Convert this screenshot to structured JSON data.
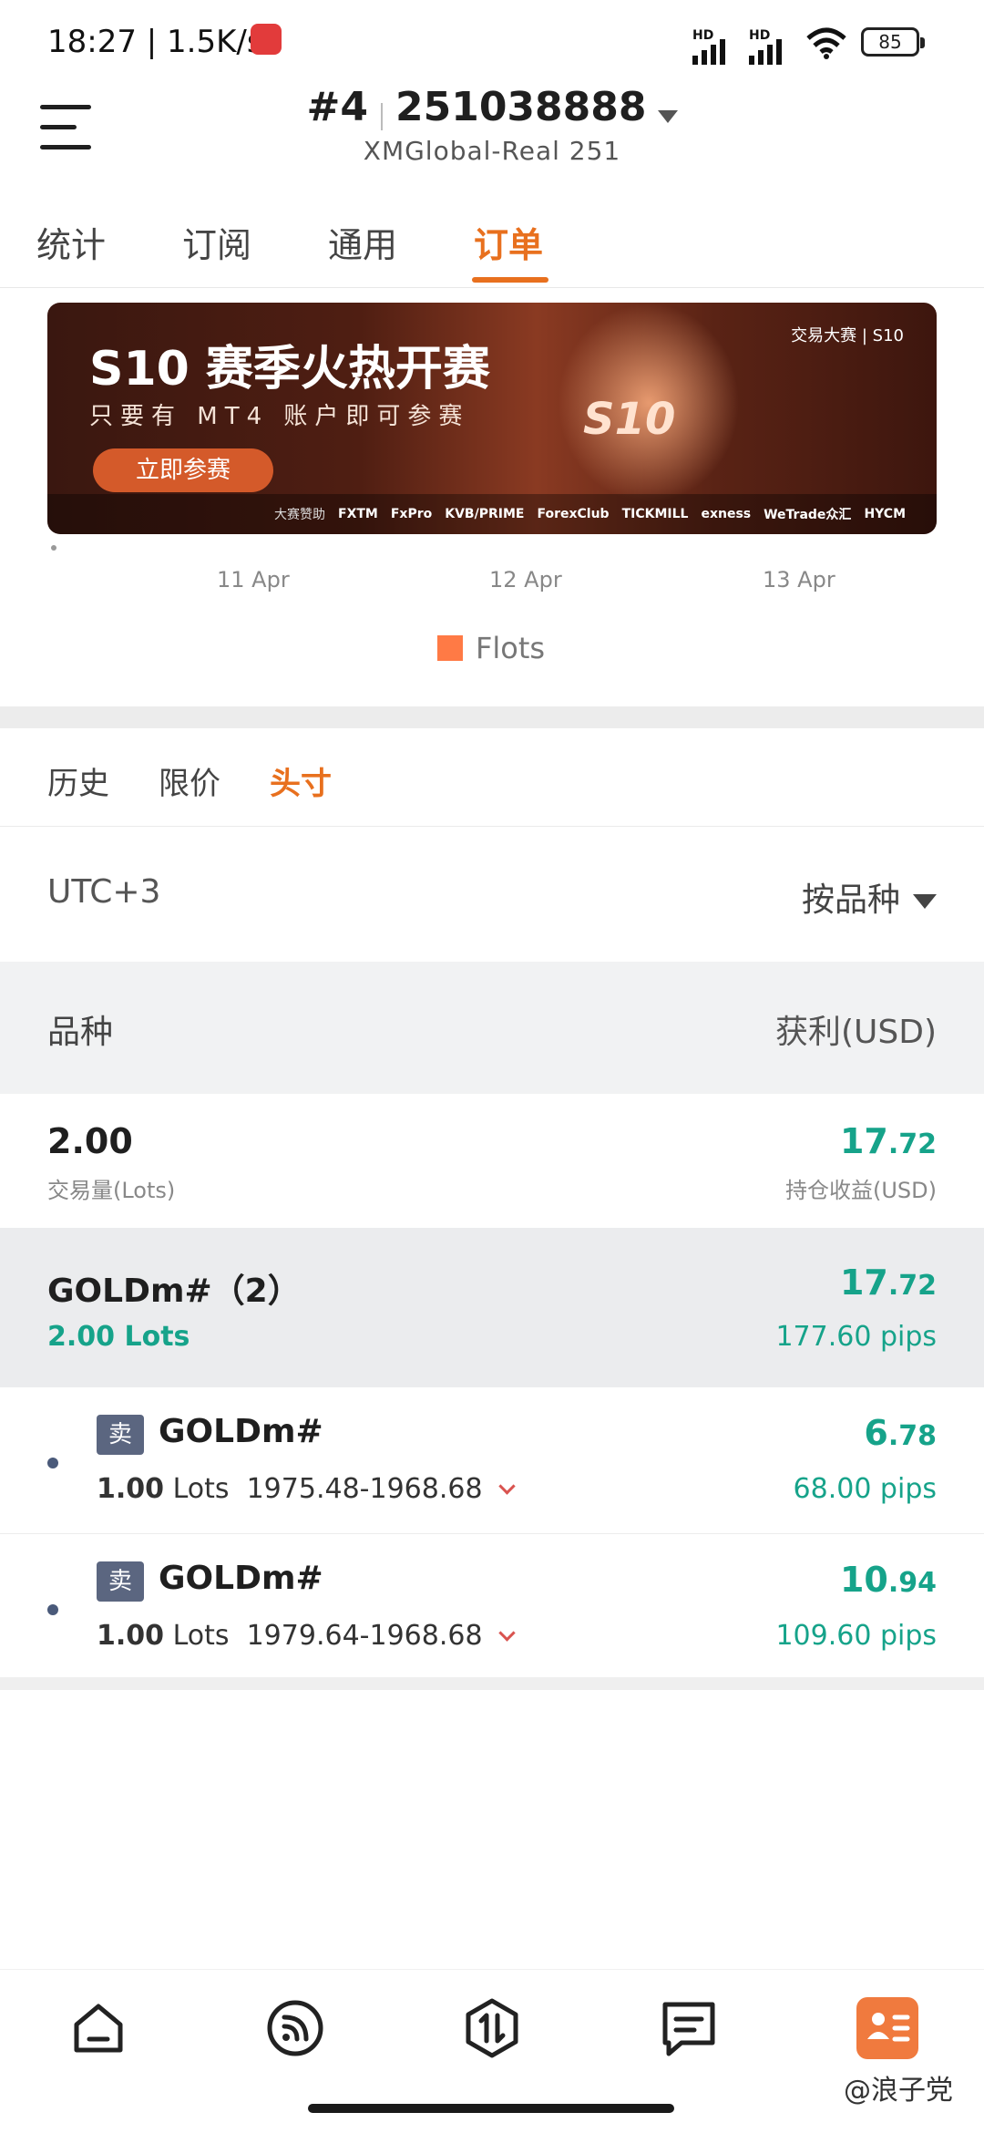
{
  "status_bar": {
    "time": "18:27 | 1.5K/s",
    "signal1_label": "HD",
    "signal2_label": "HD",
    "battery": "85"
  },
  "header": {
    "account_no": "#4",
    "account_id": "251038888",
    "server": "XMGlobal-Real 251"
  },
  "tabs": [
    "统计",
    "订阅",
    "通用",
    "订单"
  ],
  "active_tab": "订单",
  "banner": {
    "title": "S10 赛季火热开赛",
    "subtitle": "只要有 MT4 账户即可参赛",
    "cta": "立即参赛",
    "brand": "交易大赛 | S10",
    "center_text": "S10",
    "sponsor_label": "大赛赞助",
    "sponsors": [
      "FXTM",
      "FxPro",
      "KVB/PRIME",
      "ForexClub",
      "TICKMILL",
      "exness",
      "WeTrade众汇",
      "HYCM"
    ]
  },
  "chart_data": {
    "type": "bar",
    "categories": [
      "11 Apr",
      "12 Apr",
      "13 Apr"
    ],
    "series": [
      {
        "name": "Flots",
        "color": "#ff7a45"
      }
    ]
  },
  "subtabs": [
    "历史",
    "限价",
    "头寸"
  ],
  "active_subtab": "头寸",
  "filter": {
    "timezone": "UTC+3",
    "sort": "按品种"
  },
  "table_header": {
    "left": "品种",
    "right": "获利(USD)"
  },
  "summary": {
    "volume": "2.00",
    "volume_label": "交易量(Lots)",
    "profit_int": "17",
    "profit_dec": ".72",
    "profit_label": "持仓收益(USD)"
  },
  "group": {
    "name": "GOLDm#（2）",
    "lots": "2.00 Lots",
    "profit_int": "17",
    "profit_dec": ".72",
    "pips": "177.60 pips"
  },
  "positions": [
    {
      "side": "卖",
      "symbol": "GOLDm#",
      "lots": "1.00",
      "lots_unit": "Lots",
      "prices": "1975.48-1968.68",
      "profit_int": "6",
      "profit_dec": ".78",
      "pips": "68.00 pips"
    },
    {
      "side": "卖",
      "symbol": "GOLDm#",
      "lots": "1.00",
      "lots_unit": "Lots",
      "prices": "1979.64-1968.68",
      "profit_int": "10",
      "profit_dec": ".94",
      "pips": "109.60 pips"
    }
  ],
  "nav": {
    "items": [
      "home-icon",
      "feed-icon",
      "trade-icon",
      "message-icon",
      "profile-card-icon"
    ],
    "active": "profile-card-icon"
  },
  "watermark": "@浪子党",
  "colors": {
    "accent": "#e8701e",
    "profit": "#16a38a",
    "sell_tag": "#5b6680"
  }
}
